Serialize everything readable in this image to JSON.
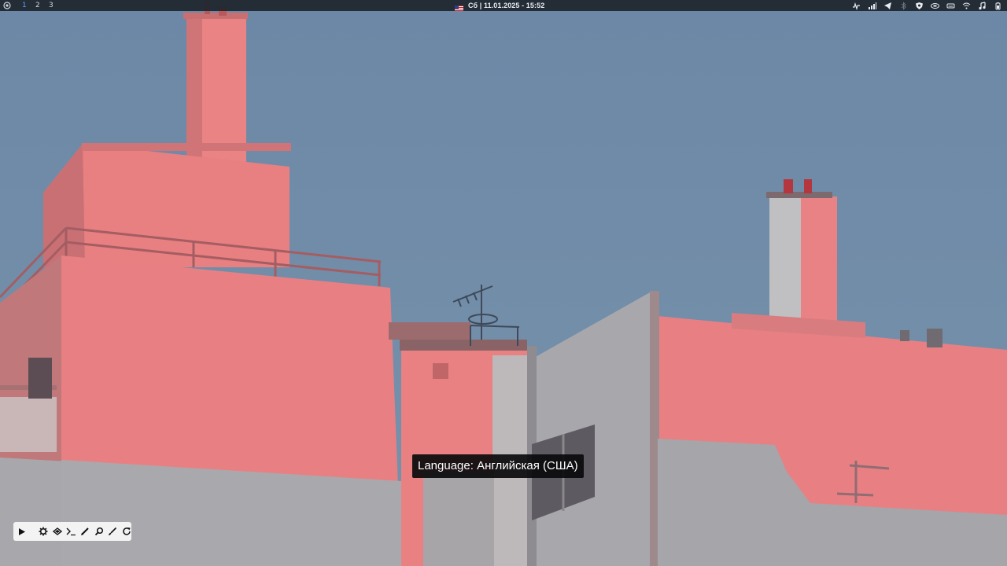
{
  "topbar": {
    "workspaces": [
      {
        "label": "1",
        "active": true
      },
      {
        "label": "2",
        "active": false
      },
      {
        "label": "3",
        "active": false
      }
    ],
    "clock": "Сб | 11.01.2025 - 15:52",
    "keyboard_flag": "us-flag-icon",
    "tray_icons": [
      "pulse-icon",
      "signal-bars-icon",
      "telegram-icon",
      "bluetooth-icon",
      "shield-icon",
      "cpu-chip-icon",
      "disk-icon",
      "wifi-icon",
      "music-note-icon",
      "battery-icon"
    ]
  },
  "tooltip": {
    "text": "Language: Английская (США)"
  },
  "toolbar": {
    "buttons": [
      "play-icon",
      "gear-icon",
      "toolbox-icon",
      "terminal-icon",
      "pen-icon",
      "search-icon",
      "brush-icon",
      "refresh-icon"
    ]
  },
  "colors": {
    "sky": "#6f8aa6",
    "building_lit": "#e97f80",
    "building_shadow": "#a9aaae",
    "topbar_bg": "#1e242c",
    "active_workspace": "#5aa0ff"
  }
}
